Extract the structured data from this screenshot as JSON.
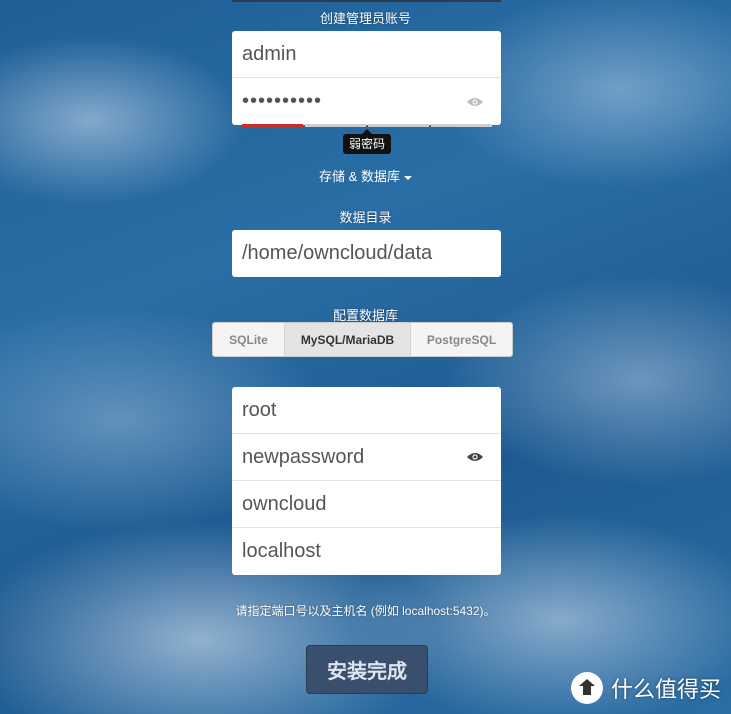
{
  "admin": {
    "section_label": "创建管理员账号",
    "username_value": "admin",
    "password_value": "••••••••••",
    "strength_level": 0.25,
    "strength_tooltip": "弱密码"
  },
  "storage_toggle": {
    "label": "存储 & 数据库"
  },
  "data_dir": {
    "section_label": "数据目录",
    "value": "/home/owncloud/data"
  },
  "database": {
    "section_label": "配置数据库",
    "options": [
      "SQLite",
      "MySQL/MariaDB",
      "PostgreSQL"
    ],
    "selected": "MySQL/MariaDB",
    "db_user": "root",
    "db_password": "newpassword",
    "db_name": "owncloud",
    "db_host": "localhost"
  },
  "hint": "请指定端口号以及主机名 (例如 localhost:5432)。",
  "install_button": "安装完成",
  "watermark": {
    "text": "什么值得买",
    "logo_glyph": "值"
  },
  "colors": {
    "strength_weak": "#c9302c",
    "button_bg": "#3a4e6e",
    "sky_blue": "#2a6ea6"
  }
}
